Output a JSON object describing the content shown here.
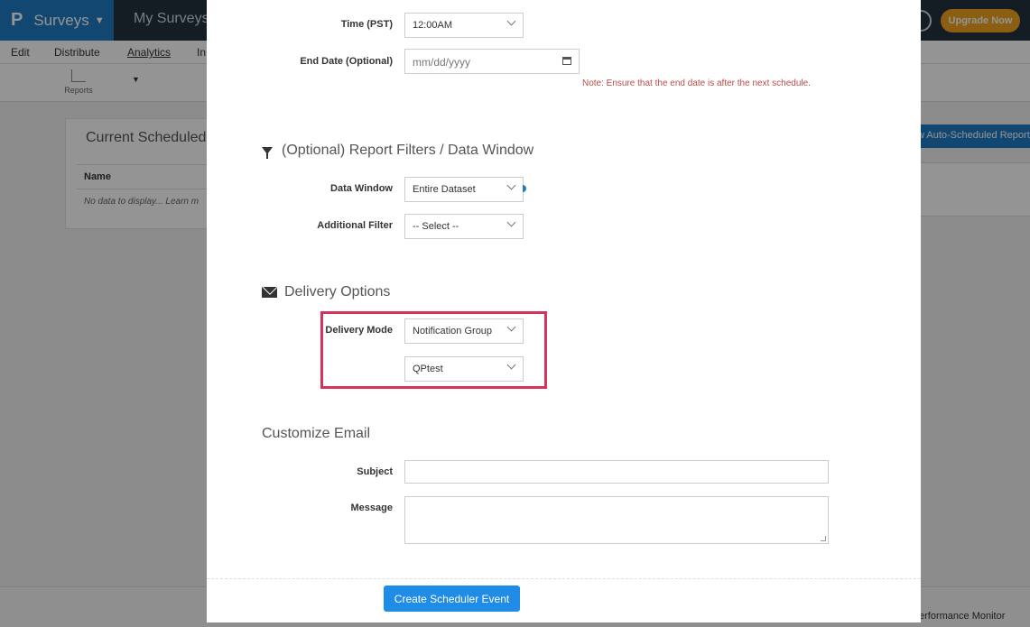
{
  "app": {
    "brand": "Surveys",
    "nav_mysurveys": "My Surveys",
    "upgrade": "Upgrade Now",
    "menu": [
      "Edit",
      "Distribute",
      "Analytics",
      "In"
    ],
    "toolbar_reports": "Reports",
    "panel_title": "Current Scheduled",
    "panel_col_name": "Name",
    "panel_empty": "No data to display... Learn m",
    "right_button": "w Auto-Scheduled Report",
    "footer_link": "erformance Monitor"
  },
  "form": {
    "time_label": "Time (PST)",
    "time_value": "12:00AM",
    "end_date_label": "End Date (Optional)",
    "end_date_placeholder": "mm/dd/yyyy",
    "end_date_note": "Note: Ensure that the end date is after the next schedule.",
    "filters_title": "(Optional) Report Filters / Data Window",
    "data_window_label": "Data Window",
    "data_window_value": "Entire Dataset",
    "additional_filter_label": "Additional Filter",
    "additional_filter_value": "-- Select --",
    "delivery_title": "Delivery Options",
    "delivery_mode_label": "Delivery Mode",
    "delivery_mode_value": "Notification Group",
    "group_value": "QPtest",
    "customize_title": "Customize Email",
    "subject_label": "Subject",
    "subject_value": "",
    "message_label": "Message",
    "message_value": "",
    "submit": "Create Scheduler Event"
  },
  "colors": {
    "accent": "#1f8ce8",
    "highlight": "#d6335a",
    "note": "#b94a48",
    "upgrade": "#f0a31e"
  }
}
